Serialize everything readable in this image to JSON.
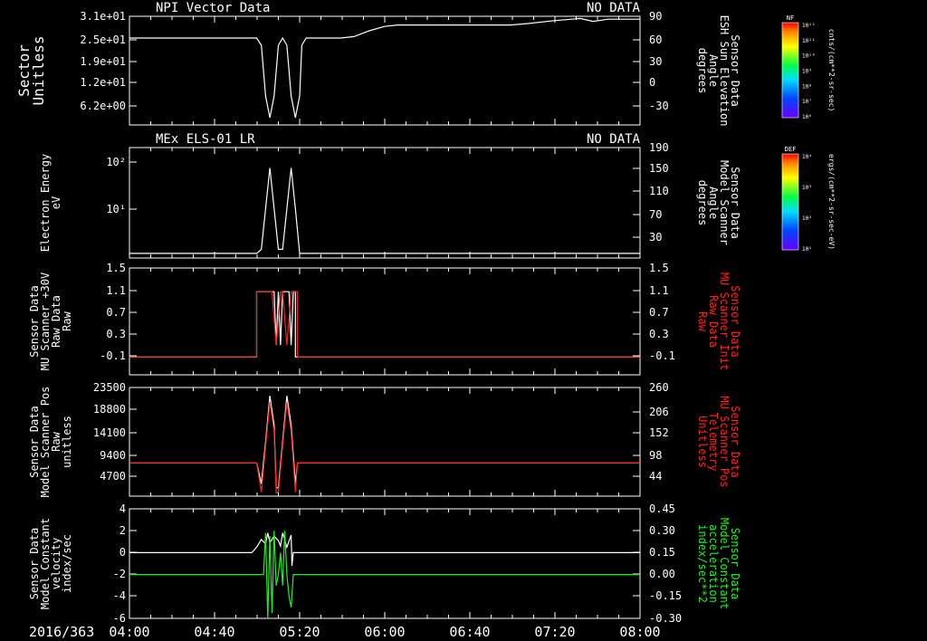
{
  "date_label": "2016/363",
  "x_ticks": [
    "04:00",
    "04:40",
    "05:20",
    "06:00",
    "06:40",
    "07:20",
    "08:00"
  ],
  "colors": {
    "background": "#000000",
    "foreground": "#ffffff",
    "red": "#ff2020",
    "green": "#22ee22"
  },
  "colorbars": [
    {
      "title": "NF",
      "units": "cnts/(cm**2-sr-sec)",
      "ticks": [
        "10¹²",
        "10¹¹",
        "10¹⁰",
        "10⁹",
        "10⁸",
        "10⁷",
        "10⁶"
      ]
    },
    {
      "title": "DEF",
      "units": "ergs/(cm**2-sr-sec-eV)",
      "ticks": [
        "10⁴",
        "10³",
        "10²",
        "10¹"
      ]
    }
  ],
  "chart_data": [
    {
      "type": "line",
      "title": "NPI Vector Data",
      "status": "NO DATA",
      "left_axis": {
        "label": [
          "Sector",
          "Unitless"
        ],
        "ticks": [
          "3.1e+01",
          "2.5e+01",
          "1.9e+01",
          "1.2e+01",
          "6.2e+00"
        ]
      },
      "right_axis": {
        "label": [
          "Sensor Data",
          "ESH Sun Elevation",
          "Angle",
          "degrees"
        ],
        "ticks": [
          "90",
          "60",
          "30",
          "0",
          "-30"
        ],
        "ylim": [
          -60,
          90
        ]
      },
      "series": [
        {
          "color": "#ffffff",
          "axis": "right",
          "x": [
            0,
            13,
            14,
            15,
            16,
            17,
            18,
            19,
            20,
            21,
            22,
            23,
            24,
            26,
            28,
            32,
            37,
            42,
            48,
            55,
            62,
            68,
            71,
            74,
            78,
            85,
            92,
            100,
            110,
            120,
            128,
            140,
            152,
            158,
            165,
            170,
            180
          ],
          "y": [
            60,
            60,
            50,
            -20,
            -50,
            -20,
            50,
            60,
            50,
            -20,
            -50,
            -20,
            50,
            60,
            60,
            60,
            60,
            60,
            62,
            70,
            76,
            78,
            78,
            78,
            78,
            78,
            78,
            78,
            78,
            78,
            80,
            84,
            87,
            83,
            86,
            86,
            86
          ]
        }
      ]
    },
    {
      "type": "line",
      "title": "MEx ELS-01 LR",
      "status": "NO DATA",
      "left_axis": {
        "label": [
          "Electron Energy",
          "eV"
        ],
        "ticks": [
          "10²",
          "10¹"
        ]
      },
      "right_axis": {
        "label": [
          "Sensor Data",
          "Model Scanner",
          "Angle",
          "degrees"
        ],
        "ticks": [
          "190",
          "150",
          "110",
          "70",
          "30"
        ],
        "ylim": [
          0,
          190
        ]
      },
      "series": [
        {
          "color": "#ffffff",
          "axis": "right",
          "x": [
            0,
            13,
            14,
            15,
            16,
            17,
            18,
            19,
            20,
            21,
            22,
            23,
            24,
            180
          ],
          "y": [
            8,
            8,
            15,
            85,
            155,
            85,
            15,
            15,
            85,
            155,
            85,
            8,
            8,
            8
          ]
        }
      ]
    },
    {
      "type": "line",
      "left_axis": {
        "label": [
          "Sensor Data",
          "MU Scanner +30V",
          "Raw Data",
          "Raw"
        ],
        "ticks": [
          "1.5",
          "1.1",
          "0.7",
          "0.3",
          "-0.1"
        ]
      },
      "right_axis": {
        "label": [
          "Sensor Data",
          "MU Scanner Init",
          "Raw Data",
          "Raw"
        ],
        "ticks": [
          "1.5",
          "1.1",
          "0.7",
          "0.3",
          "-0.1"
        ],
        "ylim": [
          -0.3,
          1.5
        ]
      },
      "series": [
        {
          "color": "#ffffff",
          "axis": "left",
          "x": [
            0,
            13,
            13,
            17,
            17.5,
            18,
            18.5,
            19,
            20.5,
            21,
            21.5,
            22,
            22,
            180
          ],
          "y": [
            0,
            0,
            1.1,
            1.1,
            0.2,
            1.1,
            0.2,
            1.1,
            1.1,
            0.2,
            1.1,
            1.1,
            0,
            0
          ]
        },
        {
          "color": "#ff2020",
          "axis": "right",
          "x": [
            0,
            13,
            13,
            16.5,
            17.5,
            18.5,
            19,
            20,
            21,
            22,
            22.5,
            22.5,
            180
          ],
          "y": [
            0,
            0,
            1.1,
            1.1,
            0.2,
            1.1,
            1.1,
            0.2,
            1.1,
            1.1,
            1.1,
            0,
            0
          ]
        }
      ]
    },
    {
      "type": "line",
      "left_axis": {
        "label": [
          "Sensor Data",
          "Model Scanner Pos",
          "Raw",
          "unitless"
        ],
        "ticks": [
          "23500",
          "18800",
          "14100",
          "9400",
          "4700"
        ]
      },
      "right_axis": {
        "label": [
          "Sensor Data",
          "MU Scanner Pos",
          "Telemetry",
          "Unitless"
        ],
        "ticks": [
          "260",
          "206",
          "152",
          "98",
          "44"
        ],
        "ylim": [
          0,
          260
        ]
      },
      "series": [
        {
          "color": "#ffffff",
          "axis": "right",
          "x": [
            0,
            13,
            14,
            15,
            16,
            17,
            17.5,
            18,
            19,
            20,
            21,
            22,
            22.5,
            180
          ],
          "y": [
            80,
            80,
            30,
            130,
            240,
            170,
            20,
            20,
            130,
            240,
            170,
            30,
            80,
            80
          ]
        },
        {
          "color": "#ff2020",
          "axis": "right",
          "x": [
            0,
            13,
            14,
            15,
            16,
            17,
            17.5,
            18,
            19,
            20,
            21,
            22,
            22.5,
            180
          ],
          "y": [
            80,
            80,
            10,
            120,
            225,
            155,
            8,
            10,
            120,
            225,
            155,
            10,
            80,
            80
          ]
        }
      ]
    },
    {
      "type": "line",
      "left_axis": {
        "label": [
          "Sensor Data",
          "Model Constant",
          "velocity",
          "index/sec"
        ],
        "ticks": [
          "4",
          "2",
          "0",
          "-2",
          "-4",
          "-6"
        ]
      },
      "right_axis": {
        "label": [
          "Sensor Data",
          "Model Constant",
          "acceleration",
          "index/sec**2"
        ],
        "ticks": [
          "0.45",
          "0.30",
          "0.15",
          "0.00",
          "-0.15",
          "-0.30"
        ],
        "ylim": [
          -0.3,
          0.45
        ]
      },
      "series": [
        {
          "color": "#ffffff",
          "axis": "left",
          "x": [
            0,
            12.5,
            13,
            14,
            15,
            15.5,
            16,
            17,
            18,
            18.5,
            19,
            20,
            21,
            21.2,
            21.5,
            180
          ],
          "y": [
            0,
            0,
            0.5,
            1.2,
            0.8,
            1.8,
            0.9,
            1.5,
            1.1,
            0.6,
            1.8,
            0.5,
            1.6,
            -1.2,
            0,
            0
          ]
        },
        {
          "color": "#22ee22",
          "axis": "left",
          "x": [
            0,
            14.5,
            15,
            15.5,
            16,
            16.5,
            17,
            17.5,
            18,
            18.5,
            19,
            19.5,
            20,
            20.5,
            21,
            21.5,
            22,
            180
          ],
          "y": [
            -2,
            -2,
            1.8,
            -6,
            1.5,
            -5.5,
            2,
            -3,
            -2,
            0,
            -3,
            2,
            -2,
            -4,
            -5,
            -2,
            -2,
            -2
          ]
        }
      ]
    }
  ]
}
